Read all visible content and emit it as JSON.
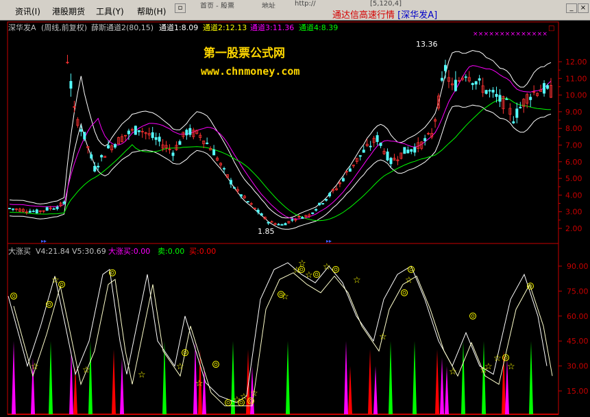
{
  "menu": {
    "items": [
      "资讯(I)",
      "港股期货",
      "工具(Y)",
      "帮助(H)"
    ]
  },
  "tabs_ghost": [
    "首页 - 股票",
    "地址",
    "http://",
    "[5,120,4]"
  ],
  "window": {
    "title_prefix": "通达信高速行情",
    "title_stock": "[深华发A]"
  },
  "main_header": {
    "stock": "深华发A",
    "period": "(周线,前复权)",
    "indicator": "薛斯通道2(80,15)",
    "ch1": "通道1:8.09",
    "ch2": "通道2:12.13",
    "ch3": "通道3:11.36",
    "ch4": "通道4:8.39",
    "high_label": "13.36",
    "low_label": "1.85"
  },
  "watermark": {
    "line1": "第一股票公式网",
    "line2": "www.chnmoney.com"
  },
  "price_axis": [
    "12.00",
    "11.00",
    "10.00",
    "9.00",
    "8.00",
    "7.00",
    "6.00",
    "5.00",
    "4.00",
    "3.00",
    "2.00"
  ],
  "sub_header": {
    "name": "大涨买",
    "v4": "V4:21.84",
    "v5": "V5:30.69",
    "buy_big": "大涨买:0.00",
    "sell": "卖:0.00",
    "buy": "买:0.00"
  },
  "osc_axis": [
    "90.00",
    "75.00",
    "60.00",
    "45.00",
    "30.00",
    "15.00"
  ],
  "colors": {
    "up": "#ff3232",
    "down": "#54fcfc",
    "ch_white": "#ffffff",
    "ch_magenta": "#ff00ff",
    "ch_green": "#00ff00",
    "grid_red": "#c80000",
    "accent_yellow": "#ffff00"
  },
  "chart_data": {
    "type": "candlestick",
    "price_range": [
      1.5,
      13.0
    ],
    "osc_range": [
      5,
      100
    ],
    "title": "深华发A (周线,前复权)"
  }
}
